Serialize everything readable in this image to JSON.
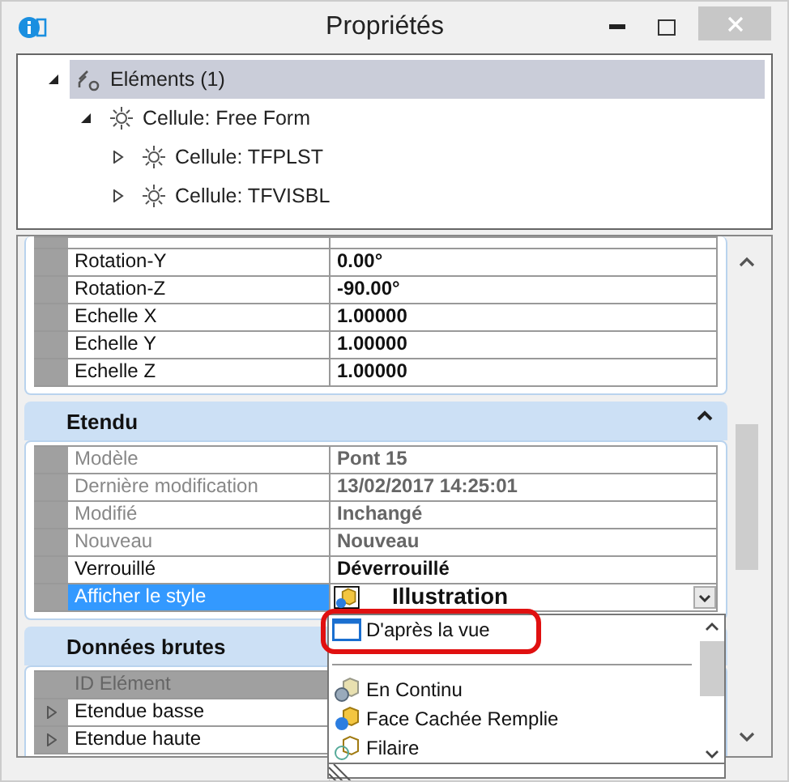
{
  "window": {
    "title": "Propriétés"
  },
  "tree": [
    {
      "label": "Eléments (1)",
      "selected": true,
      "expanded": true,
      "children": [
        {
          "label": "Cellule: Free Form",
          "selected": false,
          "expanded": true,
          "children": [
            {
              "label": "Cellule: TFPLST",
              "selected": false,
              "expanded": false
            },
            {
              "label": "Cellule: TFVISBL",
              "selected": false,
              "expanded": false
            }
          ]
        }
      ]
    }
  ],
  "top_rows": [
    {
      "label": "Rotation-Y",
      "value": "0.00°",
      "disabled": false,
      "selected": false
    },
    {
      "label": "Rotation-Z",
      "value": "-90.00°",
      "disabled": false,
      "selected": false
    },
    {
      "label": "Echelle X",
      "value": "1.00000",
      "disabled": false,
      "selected": false
    },
    {
      "label": "Echelle Y",
      "value": "1.00000",
      "disabled": false,
      "selected": false
    },
    {
      "label": "Echelle Z",
      "value": "1.00000",
      "disabled": false,
      "selected": false
    }
  ],
  "sections": [
    {
      "title": "Etendu",
      "expanded": true,
      "rows": [
        {
          "label": "Modèle",
          "value": "Pont  15",
          "disabled": true,
          "selected": false
        },
        {
          "label": "Dernière modification",
          "value": "13/02/2017 14:25:01",
          "disabled": true,
          "selected": false
        },
        {
          "label": "Modifié",
          "value": "Inchangé",
          "disabled": true,
          "selected": false
        },
        {
          "label": "Nouveau",
          "value": "Nouveau",
          "disabled": true,
          "selected": false
        },
        {
          "label": "Verrouillé",
          "value": "Déverrouillé",
          "disabled": false,
          "selected": false
        },
        {
          "label": "Afficher le style",
          "value": "Illustration",
          "disabled": false,
          "selected": true,
          "kind": "combo"
        }
      ]
    },
    {
      "title": "Données brutes",
      "rows": [
        {
          "label": "ID Elément",
          "disabled": true,
          "selected": false,
          "kind": "header"
        },
        {
          "label": "Etendue basse",
          "disabled": false,
          "selected": false,
          "kind": "expandable"
        },
        {
          "label": "Etendue haute",
          "disabled": false,
          "selected": false,
          "kind": "expandable"
        }
      ]
    }
  ],
  "dropdown": {
    "options": [
      {
        "kind": "view",
        "label": "D'après la vue",
        "highlighted": true
      },
      {
        "kind": "separator"
      },
      {
        "kind": "smooth",
        "label": "En Continu",
        "highlighted": false
      },
      {
        "kind": "filled",
        "label": "Face Cachée Remplie",
        "highlighted": false
      },
      {
        "kind": "wire",
        "label": "Filaire",
        "highlighted": false
      }
    ]
  }
}
